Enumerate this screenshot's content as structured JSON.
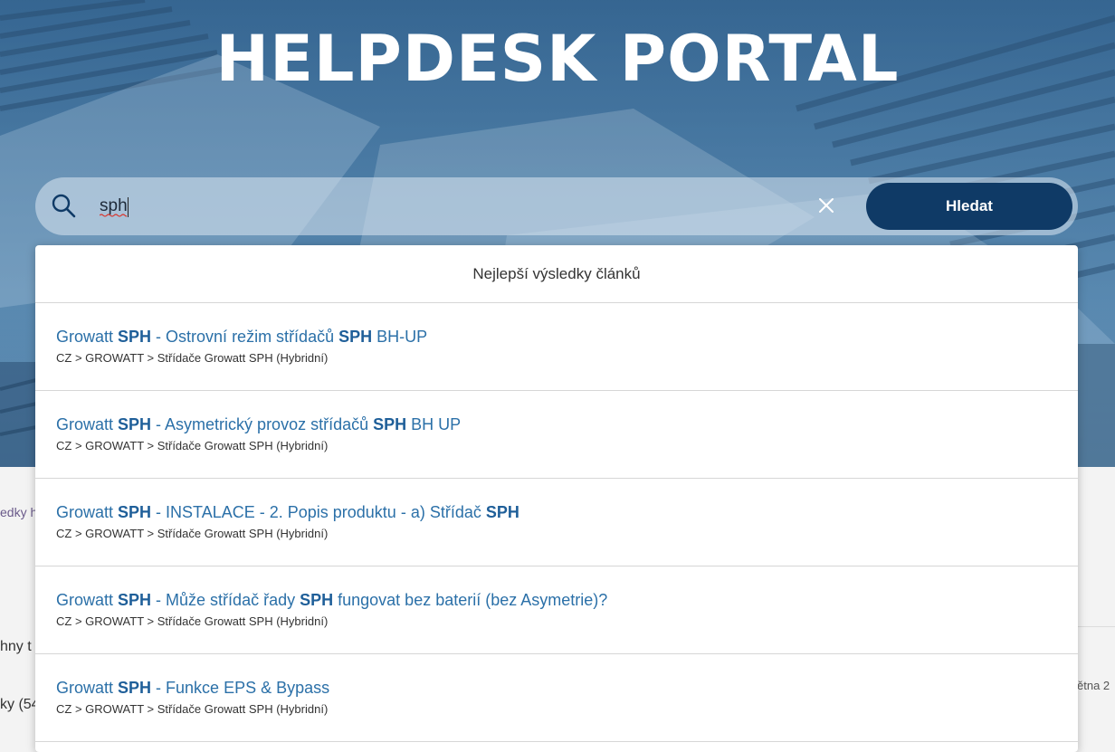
{
  "header": {
    "title": "HELPDESK PORTAL"
  },
  "search": {
    "value": "sph",
    "placeholder": "",
    "submit_label": "Hledat"
  },
  "dropdown": {
    "header": "Nejlepší výsledky článků",
    "results": [
      {
        "title_segments": [
          {
            "text": "Growatt ",
            "bold": false
          },
          {
            "text": "SPH",
            "bold": true
          },
          {
            "text": " - Ostrovní režim střídačů ",
            "bold": false
          },
          {
            "text": "SPH",
            "bold": true
          },
          {
            "text": " BH-UP",
            "bold": false
          }
        ],
        "path": "CZ > GROWATT > Střídače Growatt SPH (Hybridní)"
      },
      {
        "title_segments": [
          {
            "text": "Growatt ",
            "bold": false
          },
          {
            "text": "SPH",
            "bold": true
          },
          {
            "text": " - Asymetrický provoz střídačů ",
            "bold": false
          },
          {
            "text": "SPH",
            "bold": true
          },
          {
            "text": " BH UP",
            "bold": false
          }
        ],
        "path": "CZ > GROWATT > Střídače Growatt SPH (Hybridní)"
      },
      {
        "title_segments": [
          {
            "text": "Growatt ",
            "bold": false
          },
          {
            "text": "SPH",
            "bold": true
          },
          {
            "text": " - INSTALACE - 2. Popis produktu - a) Střídač ",
            "bold": false
          },
          {
            "text": "SPH",
            "bold": true
          }
        ],
        "path": "CZ > GROWATT > Střídače Growatt SPH (Hybridní)"
      },
      {
        "title_segments": [
          {
            "text": "Growatt ",
            "bold": false
          },
          {
            "text": "SPH",
            "bold": true
          },
          {
            "text": " - Může střídač řady ",
            "bold": false
          },
          {
            "text": "SPH",
            "bold": true
          },
          {
            "text": " fungovat bez baterií (bez Asymetrie)?",
            "bold": false
          }
        ],
        "path": "CZ > GROWATT > Střídače Growatt SPH (Hybridní)"
      },
      {
        "title_segments": [
          {
            "text": "Growatt ",
            "bold": false
          },
          {
            "text": "SPH",
            "bold": true
          },
          {
            "text": " - Funkce EPS & Bypass",
            "bold": false
          }
        ],
        "path": "CZ > GROWATT > Střídače Growatt SPH (Hybridní)"
      }
    ]
  },
  "background_fragments": {
    "left_link": "edky h",
    "left_text_1": "hny t",
    "left_text_2": "ky (54",
    "right_text": "ětna 2"
  },
  "colors": {
    "brand_dark": "#0f3a66",
    "link": "#2b70a8",
    "hero": "#4d7fa8"
  },
  "icons": {
    "search": "search-icon",
    "clear": "close-icon"
  }
}
